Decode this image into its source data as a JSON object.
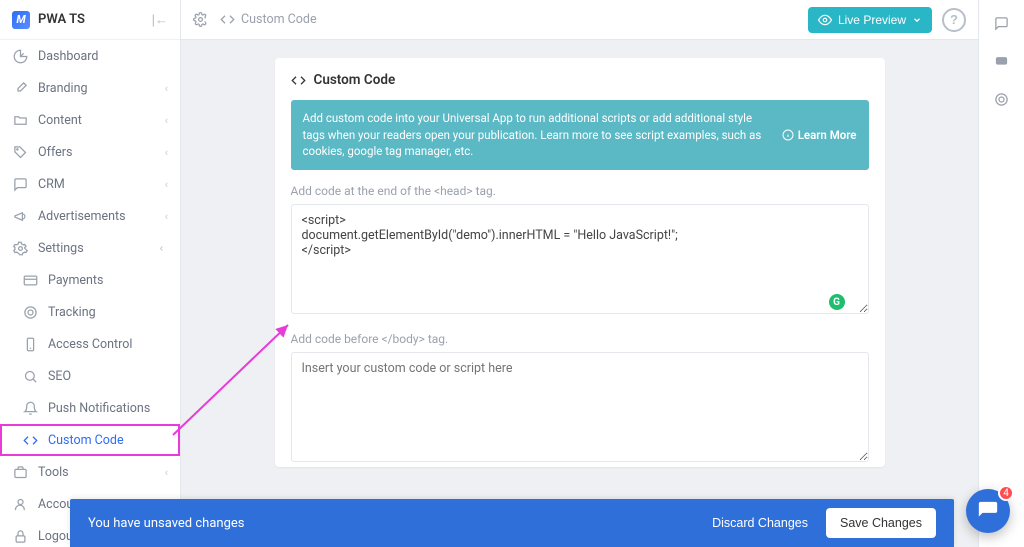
{
  "sidebar": {
    "project": "PWA TS",
    "items": [
      {
        "icon": "gauge",
        "label": "Dashboard",
        "chev": false
      },
      {
        "icon": "brush",
        "label": "Branding",
        "chev": true
      },
      {
        "icon": "folder",
        "label": "Content",
        "chev": true
      },
      {
        "icon": "tag",
        "label": "Offers",
        "chev": true
      },
      {
        "icon": "chat",
        "label": "CRM",
        "chev": true
      },
      {
        "icon": "megaphone",
        "label": "Advertisements",
        "chev": true
      },
      {
        "icon": "gear",
        "label": "Settings",
        "chev": true,
        "open": true,
        "children": [
          {
            "icon": "card",
            "label": "Payments"
          },
          {
            "icon": "target",
            "label": "Tracking"
          },
          {
            "icon": "phone",
            "label": "Access Control"
          },
          {
            "icon": "search",
            "label": "SEO"
          },
          {
            "icon": "bell",
            "label": "Push Notifications"
          },
          {
            "icon": "code",
            "label": "Custom Code",
            "active": true
          }
        ]
      },
      {
        "icon": "briefcase",
        "label": "Tools",
        "chev": true
      },
      {
        "icon": "user",
        "label": "Account",
        "chev": true
      },
      {
        "icon": "lock",
        "label": "Logout",
        "chev": false
      }
    ]
  },
  "breadcrumbs": {
    "section": "Custom Code"
  },
  "header": {
    "live_preview": "Live Preview"
  },
  "card": {
    "title": "Custom Code",
    "banner_text": "Add custom code into your Universal App to run additional scripts or add additional style tags when your readers open your publication. Learn more to see script examples, such as cookies, google tag manager, etc.",
    "learn_more": "Learn More",
    "head_label": "Add code at the end of the <head> tag.",
    "head_code": "<script>\ndocument.getElementById(\"demo\").innerHTML = \"Hello JavaScript!\";\n</script>",
    "body_label": "Add code before </body> tag.",
    "body_placeholder": "Insert your custom code or script here"
  },
  "unsaved": {
    "message": "You have unsaved changes",
    "discard": "Discard Changes",
    "save": "Save Changes"
  },
  "intercom": {
    "badge": "4"
  }
}
